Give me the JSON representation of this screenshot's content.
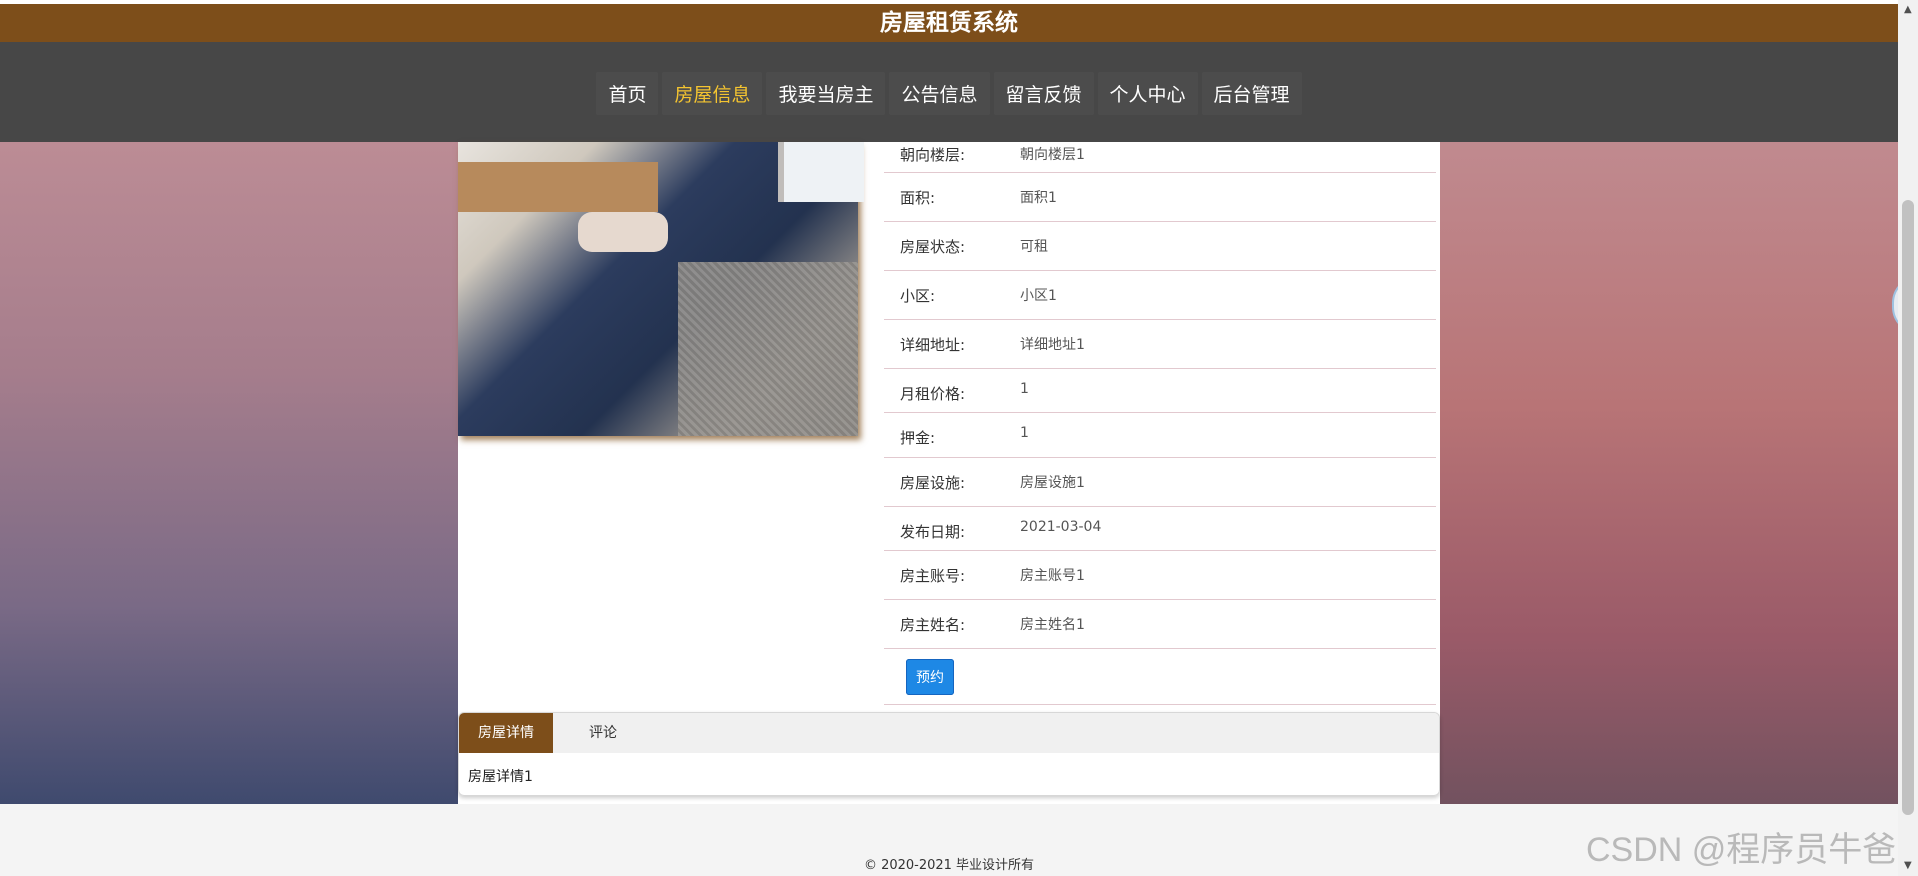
{
  "header": {
    "title": "房屋租赁系统"
  },
  "nav": {
    "items": [
      {
        "label": "首页"
      },
      {
        "label": "房屋信息",
        "active": true
      },
      {
        "label": "我要当房主"
      },
      {
        "label": "公告信息"
      },
      {
        "label": "留言反馈"
      },
      {
        "label": "个人中心"
      },
      {
        "label": "后台管理"
      }
    ],
    "active_color": "#f4c430"
  },
  "details": [
    {
      "label": "朝向楼层:",
      "value": "朝向楼层1"
    },
    {
      "label": "面积:",
      "value": "面积1"
    },
    {
      "label": "房屋状态:",
      "value": "可租"
    },
    {
      "label": "小区:",
      "value": "小区1"
    },
    {
      "label": "详细地址:",
      "value": "详细地址1"
    },
    {
      "label": "月租价格:",
      "value": "1"
    },
    {
      "label": "押金:",
      "value": "1"
    },
    {
      "label": "房屋设施:",
      "value": "房屋设施1"
    },
    {
      "label": "发布日期:",
      "value": "2021-03-04"
    },
    {
      "label": "房主账号:",
      "value": "房主账号1"
    },
    {
      "label": "房主姓名:",
      "value": "房主姓名1"
    }
  ],
  "actions": {
    "reserve_label": "预约"
  },
  "tabs": [
    {
      "label": "房屋详情",
      "active": true
    },
    {
      "label": "评论"
    }
  ],
  "tab_content": "房屋详情1",
  "footer": {
    "text": "© 2020-2021 毕业设计所有"
  },
  "watermark": "CSDN @程序员牛爸",
  "colors": {
    "brand": "#7d4e1a",
    "nav_bg": "#474747",
    "button": "#1e88e5"
  }
}
